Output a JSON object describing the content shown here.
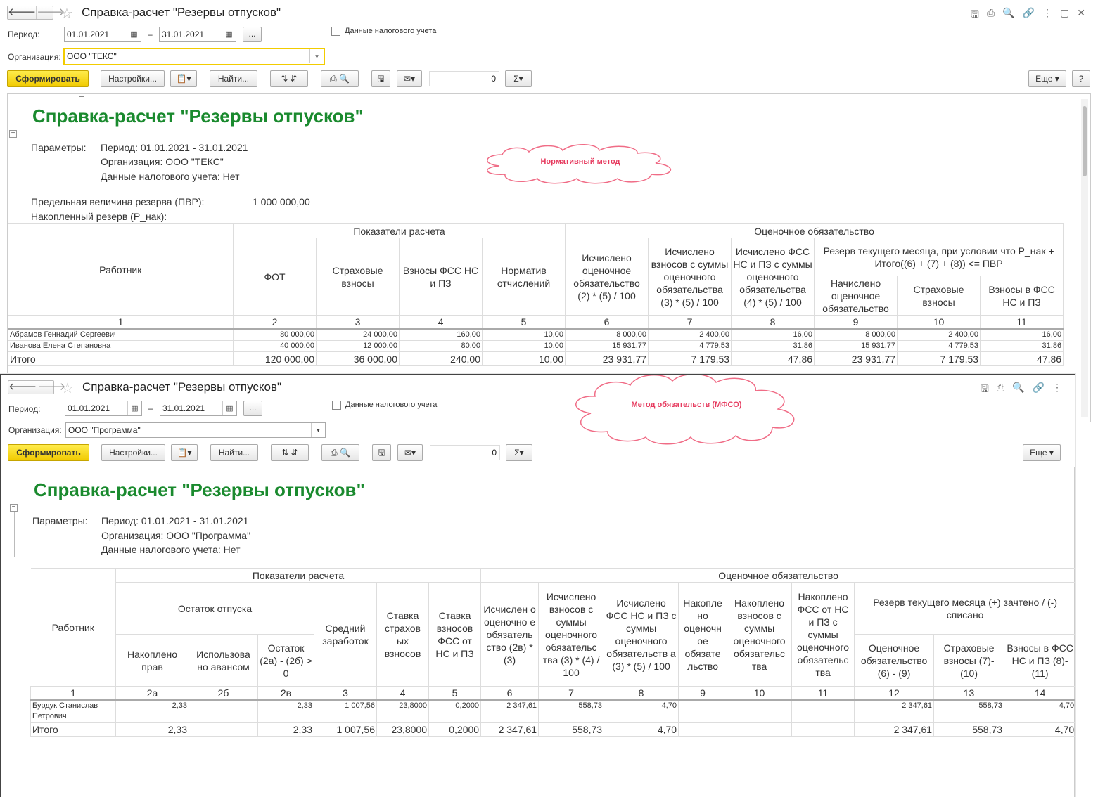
{
  "window1": {
    "title": "Справка-расчет \"Резервы отпусков\"",
    "period_label": "Период:",
    "date_from": "01.01.2021",
    "dash": "–",
    "date_to": "31.01.2021",
    "more_btn": "...",
    "tax_checkbox_label": "Данные налогового учета",
    "org_label": "Организация:",
    "org_value": "ООО \"ТЕКС\"",
    "generate_btn": "Сформировать",
    "settings_btn": "Настройки...",
    "find_btn": "Найти...",
    "sum_value": "0",
    "more_menu": "Еще",
    "help": "?",
    "report_title": "Справка-расчет \"Резервы отпусков\"",
    "params_label": "Параметры:",
    "param_period": "Период: 01.01.2021 - 31.01.2021",
    "param_org": "Организация: ООО \"ТЕКС\"",
    "param_tax": "Данные налогового учета: Нет",
    "pvr_label": "Предельная величина резерва (ПВР):",
    "pvr_value": "1 000 000,00",
    "accum_label": "Накопленный резерв (Р_нак):",
    "cloud": "Нормативный метод",
    "headers": {
      "worker": "Работник",
      "calc_indicators": "Показатели расчета",
      "estimated_liability": "Оценочное обязательство",
      "fot": "ФОТ",
      "ins": "Страховые взносы",
      "fss": "Взносы ФСС НС и ПЗ",
      "norm": "Норматив отчислений",
      "c6": "Исчислено оценочное обязательство (2) * (5) / 100",
      "c7": "Исчислено взносов с суммы оценочного обязательства (3) * (5) / 100",
      "c8": "Исчислено ФСС НС и ПЗ с суммы оценочного обязательства (4) * (5) / 100",
      "reserve": "Резерв текущего месяца, при условии что Р_нак + Итого((6) + (7) + (8)) <= ПВР",
      "c9": "Начислено оценочное обязательство",
      "c10": "Страховые взносы",
      "c11": "Взносы в ФСС НС и ПЗ",
      "nums": [
        "1",
        "2",
        "3",
        "4",
        "5",
        "6",
        "7",
        "8",
        "9",
        "10",
        "11"
      ]
    },
    "rows": [
      [
        "Абрамов Геннадий Сергеевич",
        "80 000,00",
        "24 000,00",
        "160,00",
        "10,00",
        "8 000,00",
        "2 400,00",
        "16,00",
        "8 000,00",
        "2 400,00",
        "16,00"
      ],
      [
        "Иванова Елена Степановна",
        "40 000,00",
        "12 000,00",
        "80,00",
        "10,00",
        "15 931,77",
        "4 779,53",
        "31,86",
        "15 931,77",
        "4 779,53",
        "31,86"
      ]
    ],
    "total": [
      "Итого",
      "120 000,00",
      "36 000,00",
      "240,00",
      "10,00",
      "23 931,77",
      "7 179,53",
      "47,86",
      "23 931,77",
      "7 179,53",
      "47,86"
    ]
  },
  "window2": {
    "title": "Справка-расчет \"Резервы отпусков\"",
    "period_label": "Период:",
    "date_from": "01.01.2021",
    "dash": "–",
    "date_to": "31.01.2021",
    "more_btn": "...",
    "tax_checkbox_label": "Данные налогового учета",
    "org_label": "Организация:",
    "org_value": "ООО \"Программа\"",
    "generate_btn": "Сформировать",
    "settings_btn": "Настройки...",
    "find_btn": "Найти...",
    "sum_value": "0",
    "more_menu": "Еще",
    "report_title": "Справка-расчет \"Резервы отпусков\"",
    "params_label": "Параметры:",
    "param_period": "Период: 01.01.2021 - 31.01.2021",
    "param_org": "Организация: ООО \"Программа\"",
    "param_tax": "Данные налогового учета: Нет",
    "cloud": "Метод обязательств (МФСО)",
    "headers": {
      "worker": "Работник",
      "calc_indicators": "Показатели расчета",
      "estimated_liability": "Оценочное обязательство",
      "vac_balance": "Остаток отпуска",
      "c2a": "Накоплено прав",
      "c2b": "Использова но авансом",
      "c2v": "Остаток (2а) - (2б) > 0",
      "c3": "Средний заработок",
      "c4": "Ставка страхов ых взносов",
      "c5": "Ставка взносов ФСС от НС и ПЗ",
      "c6": "Исчислен о оценочно е обязатель ство (2в) * (3)",
      "c7": "Исчислено взносов с суммы оценочного обязательс тва (3) * (4) / 100",
      "c8": "Исчислено ФСС НС и ПЗ с суммы оценочного обязательств а (3) * (5) / 100",
      "c9": "Накопле но оценочн ое обязате льство",
      "c10": "Накоплено взносов с суммы оценочного обязательс тва",
      "c11": "Накоплено ФСС от НС и ПЗ с суммы оценочного обязательс тва",
      "reserve": "Резерв текущего месяца (+) зачтено / (-) списано",
      "c12": "Оценочное обязательство (6) - (9)",
      "c13": "Страховые взносы (7)-(10)",
      "c14": "Взносы в ФСС НС и ПЗ (8)-(11)",
      "nums": [
        "1",
        "2а",
        "2б",
        "2в",
        "3",
        "4",
        "5",
        "6",
        "7",
        "8",
        "9",
        "10",
        "11",
        "12",
        "13",
        "14"
      ]
    },
    "row_name_1": "Бурдук Станислав",
    "row_name_2": "Петрович",
    "row": [
      "2,33",
      "",
      "2,33",
      "1 007,56",
      "23,8000",
      "0,2000",
      "2 347,61",
      "558,73",
      "4,70",
      "",
      "",
      "",
      "2 347,61",
      "558,73",
      "4,70"
    ],
    "total": [
      "Итого",
      "2,33",
      "",
      "2,33",
      "1 007,56",
      "23,8000",
      "0,2000",
      "2 347,61",
      "558,73",
      "4,70",
      "",
      "",
      "",
      "2 347,61",
      "558,73",
      "4,70"
    ]
  }
}
